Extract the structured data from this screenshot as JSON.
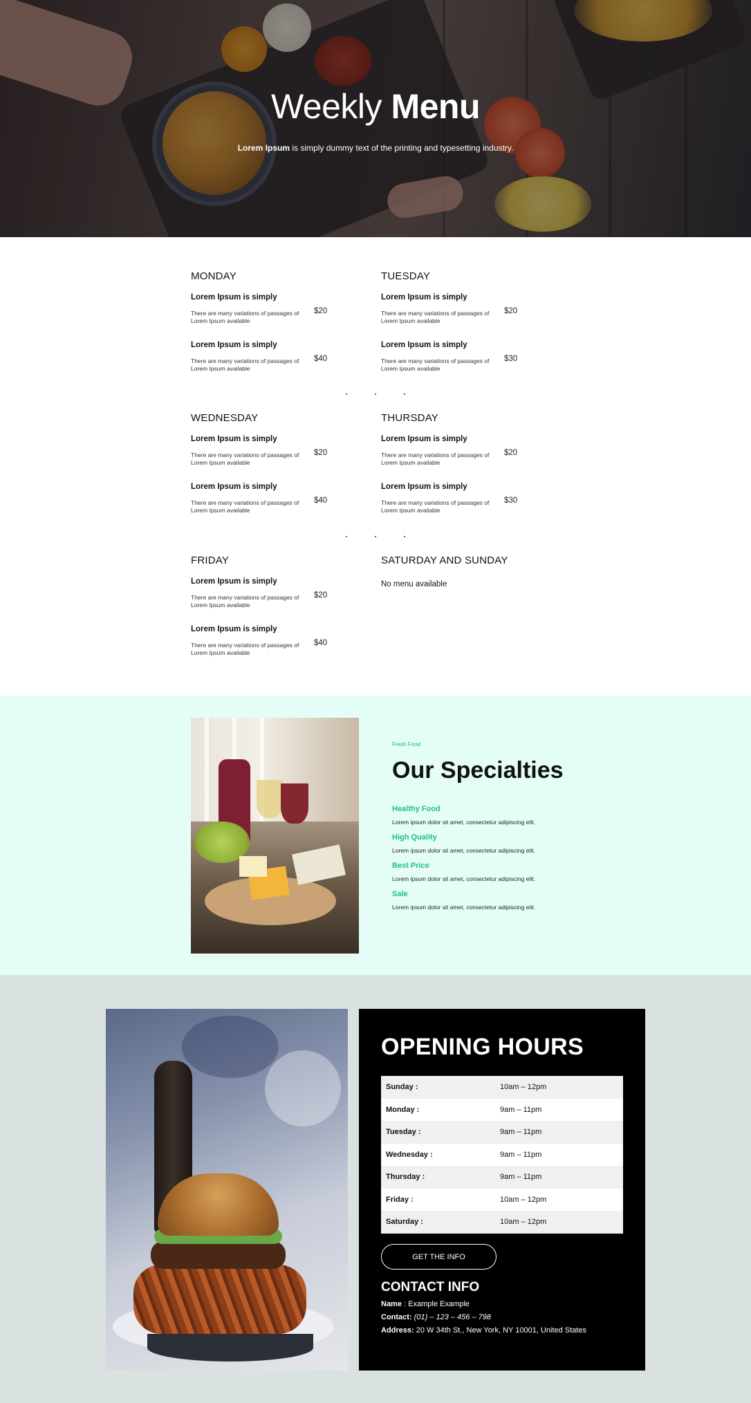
{
  "hero": {
    "title_light": "Weekly",
    "title_bold": "Menu",
    "subtitle_bold": "Lorem Ipsum",
    "subtitle_rest": " is simply dummy text of the printing and typesetting industry."
  },
  "menu": {
    "days": [
      {
        "title": "MONDAY",
        "items": [
          {
            "name": "Lorem Ipsum is simply",
            "desc": "There are many variations of passages of Lorem Ipsum available",
            "price": "$20"
          },
          {
            "name": "Lorem Ipsum is simply",
            "desc": "There are many variations of passages of Lorem Ipsum available",
            "price": "$40"
          }
        ]
      },
      {
        "title": "TUESDAY",
        "items": [
          {
            "name": "Lorem Ipsum is simply",
            "desc": "There are many variations of passages of Lorem Ipsum available",
            "price": "$20"
          },
          {
            "name": "Lorem Ipsum is simply",
            "desc": "There are many variations of passages of Lorem Ipsum available",
            "price": "$30"
          }
        ]
      },
      {
        "title": "WEDNESDAY",
        "items": [
          {
            "name": "Lorem Ipsum is simply",
            "desc": "There are many variations of passages of Lorem Ipsum available",
            "price": "$20"
          },
          {
            "name": "Lorem Ipsum is simply",
            "desc": "There are many variations of passages of Lorem Ipsum available",
            "price": "$40"
          }
        ]
      },
      {
        "title": "THURSDAY",
        "items": [
          {
            "name": "Lorem Ipsum is simply",
            "desc": "There are many variations of passages of Lorem Ipsum available",
            "price": "$20"
          },
          {
            "name": "Lorem Ipsum is simply",
            "desc": "There are many variations of passages of Lorem Ipsum available",
            "price": "$30"
          }
        ]
      },
      {
        "title": "FRIDAY",
        "items": [
          {
            "name": "Lorem Ipsum is simply",
            "desc": "There are many variations of passages of Lorem Ipsum available",
            "price": "$20"
          },
          {
            "name": "Lorem Ipsum is simply",
            "desc": "There are many variations of passages of Lorem Ipsum available",
            "price": "$40"
          }
        ]
      },
      {
        "title": "SATURDAY AND SUNDAY",
        "note": "No menu available"
      }
    ]
  },
  "specialties": {
    "eyebrow": "Fresh Food",
    "title": "Our Specialties",
    "features": [
      {
        "name": "Healthy Food",
        "desc": "Lorem ipsum dolor sit amet, consectetur adipiscing elit."
      },
      {
        "name": "High Quality",
        "desc": "Lorem ipsum dolor sit amet, consectetur adipiscing elit."
      },
      {
        "name": "Best Price",
        "desc": "Lorem ipsum dolor sit amet, consectetur adipiscing elit."
      },
      {
        "name": "Sale",
        "desc": "Lorem ipsum dolor sit amet, consectetur adipiscing elit."
      }
    ],
    "accent_color": "#1cbf86",
    "background_color": "#e4fdf7"
  },
  "hours": {
    "title": "OPENING HOURS",
    "rows": [
      {
        "day": "Sunday :",
        "time": "10am – 12pm"
      },
      {
        "day": "Monday :",
        "time": "9am – 11pm"
      },
      {
        "day": "Tuesday :",
        "time": "9am – 11pm"
      },
      {
        "day": "Wednesday :",
        "time": "9am – 11pm"
      },
      {
        "day": "Thursday :",
        "time": "9am – 11pm"
      },
      {
        "day": "Friday :",
        "time": "10am – 12pm"
      },
      {
        "day": "Saturday :",
        "time": "10am – 12pm"
      }
    ],
    "button_label": "GET THE INFO"
  },
  "contact": {
    "title": "CONTACT INFO",
    "name_label": "Name",
    "name_value": " : Example Example",
    "contact_label": "Contact:",
    "contact_value": " (01) – 123 – 456 – 798",
    "address_label": "Address:",
    "address_value": " 20 W 34th St., New York, NY 10001, United States"
  }
}
